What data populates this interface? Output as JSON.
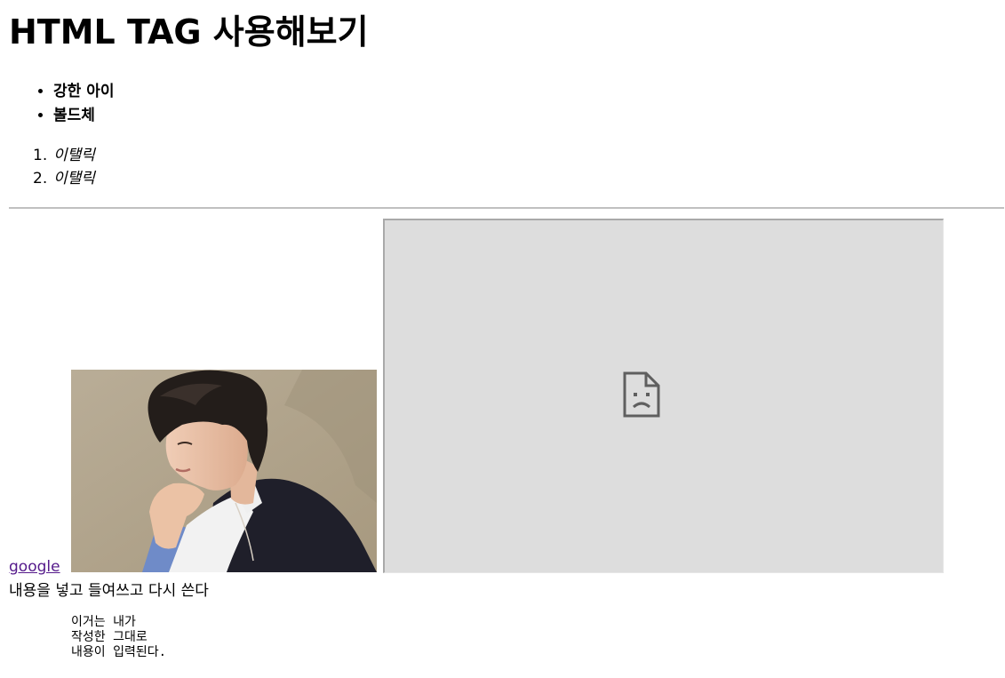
{
  "page": {
    "title": "HTML TAG 사용해보기"
  },
  "unordered_list": [
    "강한 아이",
    "볼드체"
  ],
  "ordered_list": [
    {
      "number": "1.",
      "text": "이탤릭"
    },
    {
      "number": "2.",
      "text": "이탤릭"
    }
  ],
  "link": {
    "text": "google"
  },
  "icons": {
    "broken_frame": "sad-page-icon"
  },
  "paragraph": "내용을 넣고 들여쓰고 다시 쓴다",
  "preformatted": "이거는 내가\n작성한 그대로\n내용이 입력된다."
}
